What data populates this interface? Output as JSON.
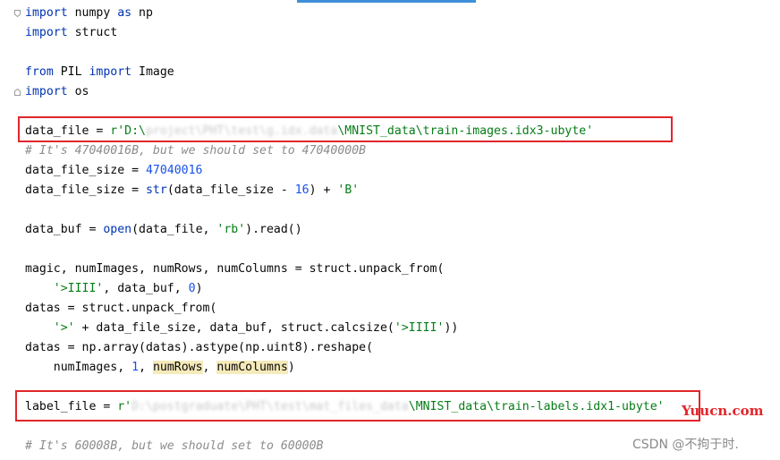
{
  "code": {
    "l01": {
      "kw1": "import",
      "t2": " numpy ",
      "kw3": "as",
      "t4": " np"
    },
    "l02": {
      "kw1": "import",
      "t2": " struct"
    },
    "l04": {
      "kw1": "from",
      "t2": " PIL ",
      "kw3": "import",
      "t4": " Image"
    },
    "l05": {
      "kw1": "import",
      "t2": " os"
    },
    "l07": {
      "t1": "data_file = ",
      "s1": "r'D:\\",
      "blur": "project\\PHT\\test\\g.idx.data",
      "s2": "\\MNIST_data\\train-images.idx3-ubyte'"
    },
    "l08": {
      "c": "# It's 47040016B, but we should set to 47040000B"
    },
    "l09": {
      "t1": "data_file_size = ",
      "n1": "47040016"
    },
    "l10": {
      "t1": "data_file_size = ",
      "b1": "str",
      "t2": "(data_file_size - ",
      "n1": "16",
      "t3": ") + ",
      "s1": "'B'"
    },
    "l12": {
      "t1": "data_buf = ",
      "b1": "open",
      "t2": "(data_file, ",
      "s1": "'rb'",
      "t3": ").read()"
    },
    "l14": {
      "t1": "magic, numImages, numRows, numColumns = struct.unpack_from("
    },
    "l15": {
      "ind": "    ",
      "s1": "'>IIII'",
      "t1": ", data_buf, ",
      "n1": "0",
      "t2": ")"
    },
    "l16": {
      "t1": "datas = struct.unpack_from("
    },
    "l17": {
      "ind": "    ",
      "s1": "'>'",
      "t1": " + data_file_size, data_buf, struct.calcsize(",
      "s2": "'>IIII'",
      "t2": "))"
    },
    "l18": {
      "t1": "datas = np.array(datas).astype(np.uint8).reshape("
    },
    "l19": {
      "ind": "    ",
      "t1": "numImages, ",
      "n1": "1",
      "t2": ", ",
      "h1": "numRows",
      "t3": ", ",
      "h2": "numColumns",
      "t4": ")"
    },
    "l21": {
      "t1": "label_file = ",
      "s1": "r'",
      "blur": "D:\\postgraduate\\PHT\\test\\mat_files_data",
      "s2": "\\MNIST_data\\train-labels.idx1-ubyte'"
    },
    "l23": {
      "c": "# It's 60008B, but we should set to 60000B"
    }
  },
  "watermarks": {
    "site": "Yuucn.com",
    "csdn": "CSDN @不拘于时."
  },
  "colors": {
    "keyword": "#0033b3",
    "string": "#067d17",
    "number": "#1750eb",
    "comment": "#8c8c8c",
    "highlight": "#f5eaba",
    "annotation_box": "#e0262b"
  }
}
